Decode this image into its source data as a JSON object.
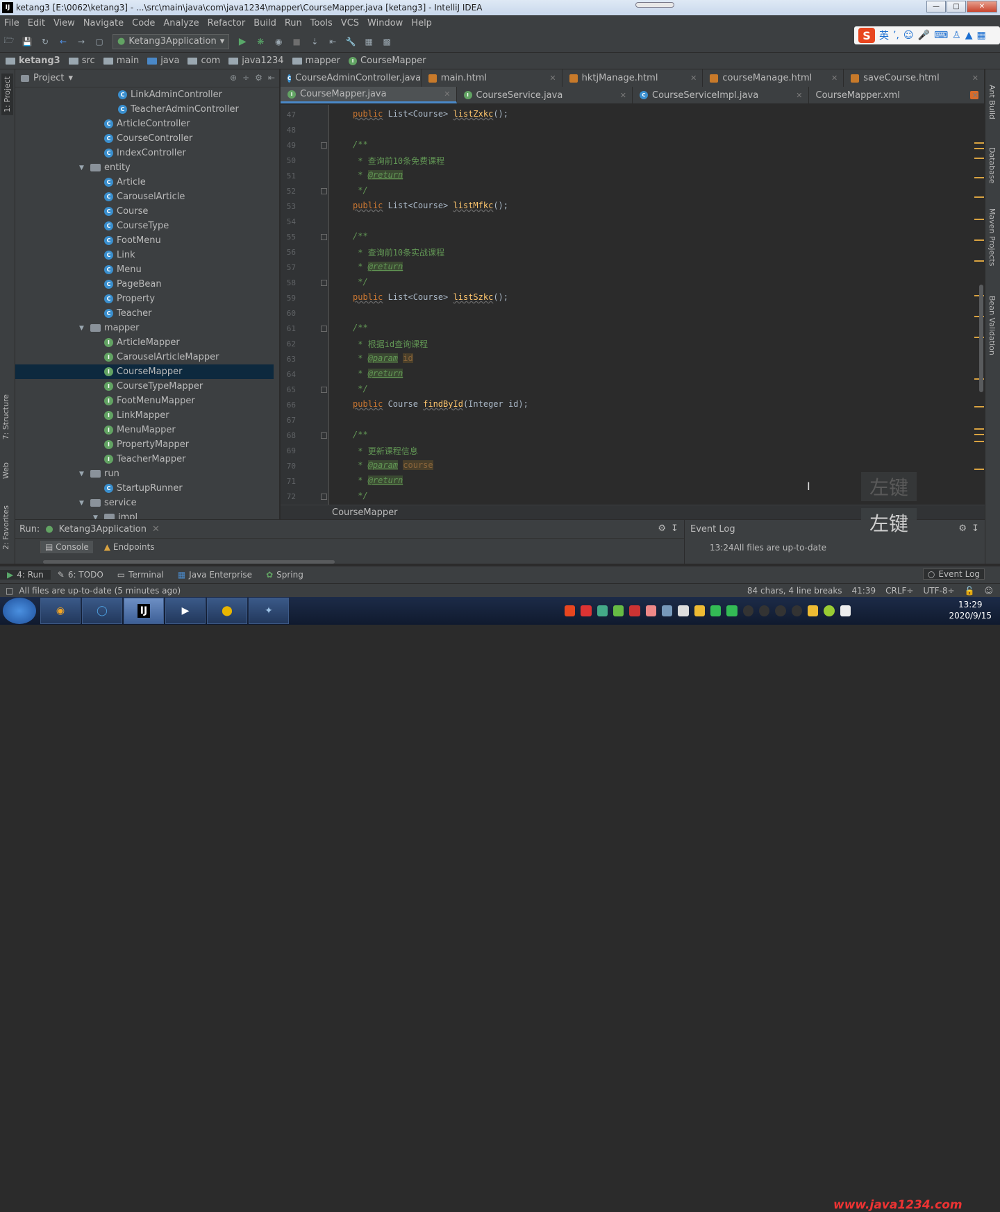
{
  "window_title": "ketang3 [E:\\0062\\ketang3] - ...\\src\\main\\java\\com\\java1234\\mapper\\CourseMapper.java [ketang3] - IntelliJ IDEA",
  "menu": [
    "File",
    "Edit",
    "View",
    "Navigate",
    "Code",
    "Analyze",
    "Refactor",
    "Build",
    "Run",
    "Tools",
    "VCS",
    "Window",
    "Help"
  ],
  "ime": {
    "lang": "英"
  },
  "run_config": "Ketang3Application",
  "breadcrumb": [
    "ketang3",
    "src",
    "main",
    "java",
    "com",
    "java1234",
    "mapper",
    "CourseMapper"
  ],
  "project_panel": {
    "title": "Project"
  },
  "tree": [
    {
      "label": "LinkAdminController",
      "type": "class",
      "indent": 7
    },
    {
      "label": "TeacherAdminController",
      "type": "class",
      "indent": 7
    },
    {
      "label": "ArticleController",
      "type": "class",
      "indent": 6
    },
    {
      "label": "CourseController",
      "type": "class",
      "indent": 6
    },
    {
      "label": "IndexController",
      "type": "class",
      "indent": 6
    },
    {
      "label": "entity",
      "type": "folder",
      "indent": 5
    },
    {
      "label": "Article",
      "type": "class",
      "indent": 6
    },
    {
      "label": "CarouselArticle",
      "type": "class",
      "indent": 6
    },
    {
      "label": "Course",
      "type": "class",
      "indent": 6
    },
    {
      "label": "CourseType",
      "type": "class",
      "indent": 6
    },
    {
      "label": "FootMenu",
      "type": "class",
      "indent": 6
    },
    {
      "label": "Link",
      "type": "class",
      "indent": 6
    },
    {
      "label": "Menu",
      "type": "class",
      "indent": 6
    },
    {
      "label": "PageBean",
      "type": "class",
      "indent": 6
    },
    {
      "label": "Property",
      "type": "class",
      "indent": 6
    },
    {
      "label": "Teacher",
      "type": "class",
      "indent": 6
    },
    {
      "label": "mapper",
      "type": "folder",
      "indent": 5
    },
    {
      "label": "ArticleMapper",
      "type": "iface",
      "indent": 6
    },
    {
      "label": "CarouselArticleMapper",
      "type": "iface",
      "indent": 6
    },
    {
      "label": "CourseMapper",
      "type": "iface",
      "indent": 6,
      "selected": true
    },
    {
      "label": "CourseTypeMapper",
      "type": "iface",
      "indent": 6
    },
    {
      "label": "FootMenuMapper",
      "type": "iface",
      "indent": 6
    },
    {
      "label": "LinkMapper",
      "type": "iface",
      "indent": 6
    },
    {
      "label": "MenuMapper",
      "type": "iface",
      "indent": 6
    },
    {
      "label": "PropertyMapper",
      "type": "iface",
      "indent": 6
    },
    {
      "label": "TeacherMapper",
      "type": "iface",
      "indent": 6
    },
    {
      "label": "run",
      "type": "folder",
      "indent": 5
    },
    {
      "label": "StartupRunner",
      "type": "class",
      "indent": 6
    },
    {
      "label": "service",
      "type": "folder",
      "indent": 5
    },
    {
      "label": "impl",
      "type": "folder",
      "indent": 6
    }
  ],
  "tabs_row1": [
    {
      "label": "CourseAdminController.java",
      "icon": "c"
    },
    {
      "label": "main.html",
      "icon": "h"
    },
    {
      "label": "hktjManage.html",
      "icon": "h"
    },
    {
      "label": "courseManage.html",
      "icon": "h"
    },
    {
      "label": "saveCourse.html",
      "icon": "h"
    }
  ],
  "tabs_row2": [
    {
      "label": "CourseMapper.java",
      "icon": "i",
      "active": true
    },
    {
      "label": "CourseService.java",
      "icon": "i"
    },
    {
      "label": "CourseServiceImpl.java",
      "icon": "c"
    },
    {
      "label": "CourseMapper.xml",
      "icon": "x"
    }
  ],
  "line_numbers": [
    "47",
    "48",
    "49",
    "50",
    "51",
    "52",
    "53",
    "54",
    "55",
    "56",
    "57",
    "58",
    "59",
    "60",
    "61",
    "62",
    "63",
    "64",
    "65",
    "66",
    "67",
    "68",
    "69",
    "70",
    "71",
    "72"
  ],
  "code": {
    "l47": {
      "kw": "public",
      "type": " List<Course> ",
      "fn": "listZxkc",
      "rest": "();"
    },
    "l49": "/**",
    "l50_prefix": " * ",
    "l50_text": "查询前10条免费课程",
    "l51_prefix": " * ",
    "l51_tag": "@return",
    "l52": " */",
    "l53": {
      "kw": "public",
      "type": " List<Course> ",
      "fn": "listMfkc",
      "rest": "();"
    },
    "l55": "/**",
    "l56_prefix": " * ",
    "l56_text": "查询前10条实战课程",
    "l57_prefix": " * ",
    "l57_tag": "@return",
    "l58": " */",
    "l59": {
      "kw": "public",
      "type": " List<Course> ",
      "fn": "listSzkc",
      "rest": "();"
    },
    "l61": "/**",
    "l62_prefix": " * ",
    "l62_text": "根据id查询课程",
    "l63_prefix": " * ",
    "l63_tag": "@param",
    "l63_param": "id",
    "l64_prefix": " * ",
    "l64_tag": "@return",
    "l65": " */",
    "l66": {
      "kw": "public",
      "type": " Course ",
      "fn": "findById",
      "rest": "(Integer id);"
    },
    "l68": "/**",
    "l69_prefix": " * ",
    "l69_text": "更新课程信息",
    "l70_prefix": " * ",
    "l70_tag": "@param",
    "l70_param": "course",
    "l71_prefix": " * ",
    "l71_tag": "@return",
    "l72": " */"
  },
  "editor_breadcrumb": "CourseMapper",
  "right_tabs": [
    "Ant Build",
    "Database",
    "Maven Projects",
    "Bean Validation"
  ],
  "left_tabs": [
    "1: Project",
    "7: Structure",
    "Web",
    "2: Favorites"
  ],
  "run_panel": {
    "label": "Run:",
    "config": "Ketang3Application",
    "tab_console": "Console",
    "tab_endpoints": "Endpoints"
  },
  "event_log": {
    "title": "Event Log",
    "time": "13:24",
    "message": "All files are up-to-date"
  },
  "overlay": {
    "left_click_1": "左键",
    "left_click_2": "左键"
  },
  "tool_tabs": [
    {
      "label": "4: Run",
      "active": true
    },
    {
      "label": "6: TODO"
    },
    {
      "label": "Terminal"
    },
    {
      "label": "Java Enterprise"
    },
    {
      "label": "Spring"
    }
  ],
  "tool_event_log": "Event Log",
  "status": {
    "message": "All files are up-to-date (5 minutes ago)",
    "chars": "84 chars, 4 line breaks",
    "pos": "41:39",
    "line_sep": "CRLF÷",
    "encoding": "UTF-8÷"
  },
  "clock": {
    "time": "13:29",
    "date": "2020/9/15"
  },
  "watermark": "www.java1234.com",
  "taskbar_apps": [
    "",
    "",
    "IJ",
    "",
    "",
    ""
  ]
}
